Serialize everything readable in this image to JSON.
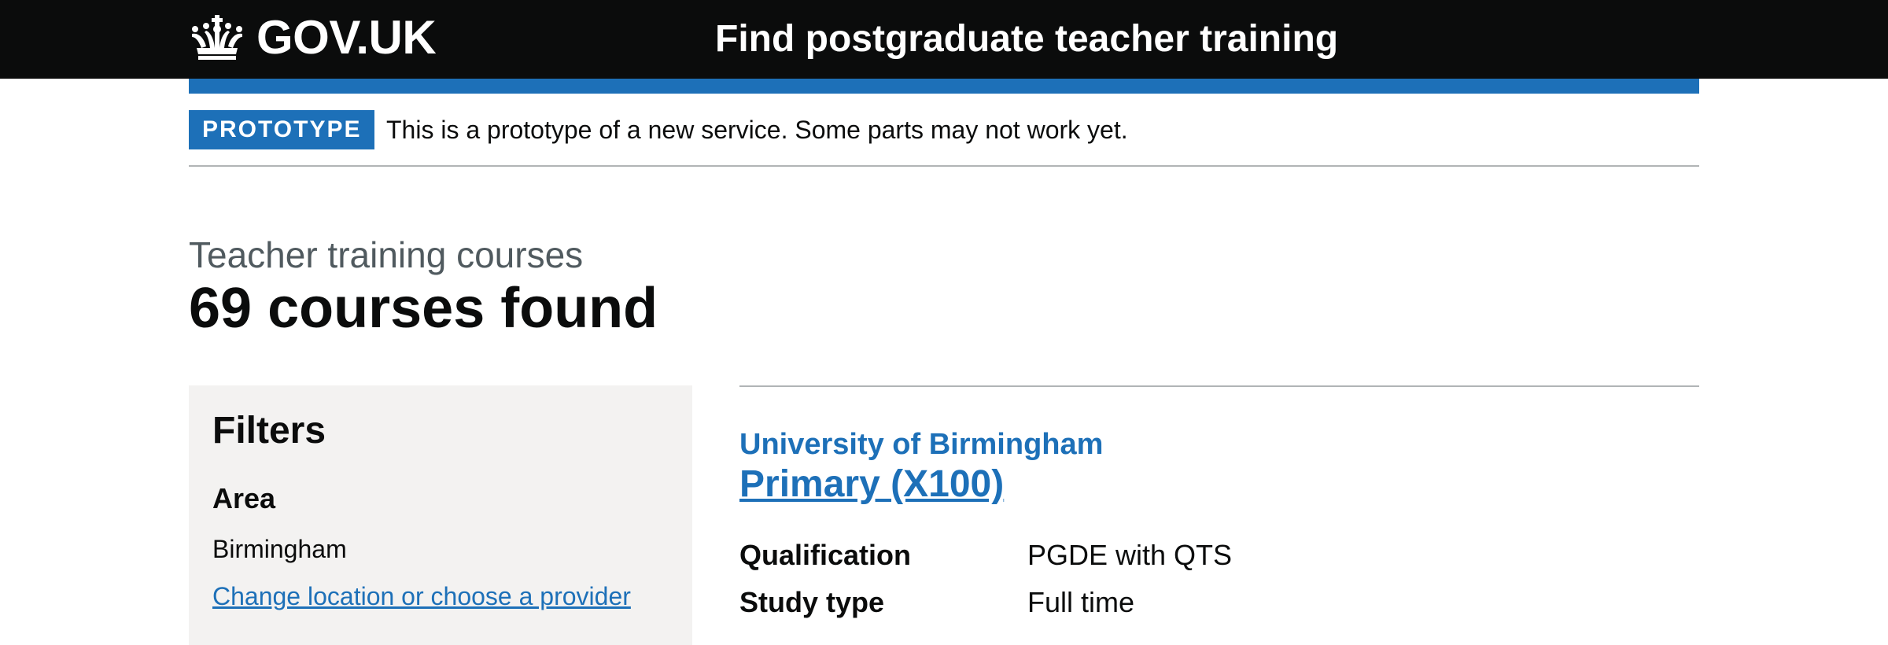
{
  "header": {
    "logo_text": "GOV.UK",
    "service_name": "Find postgraduate teacher training"
  },
  "phase_banner": {
    "tag": "PROTOTYPE",
    "text": "This is a prototype of a new service. Some parts may not work yet."
  },
  "heading": {
    "caption": "Teacher training courses",
    "title": "69 courses found"
  },
  "filters": {
    "title": "Filters",
    "area": {
      "heading": "Area",
      "value": "Birmingham",
      "change_link": "Change location or choose a provider"
    }
  },
  "results": [
    {
      "provider": "University of Birmingham",
      "course": "Primary (X100)",
      "details": [
        {
          "key": "Qualification",
          "value": "PGDE with QTS"
        },
        {
          "key": "Study type",
          "value": "Full time"
        }
      ]
    }
  ],
  "colors": {
    "header_bg": "#0b0c0c",
    "brand_blue": "#1d70b8",
    "filter_bg": "#f3f2f1",
    "secondary_text": "#505a5f",
    "border": "#b1b4b6"
  },
  "icons": {
    "logo": "crown-icon"
  }
}
